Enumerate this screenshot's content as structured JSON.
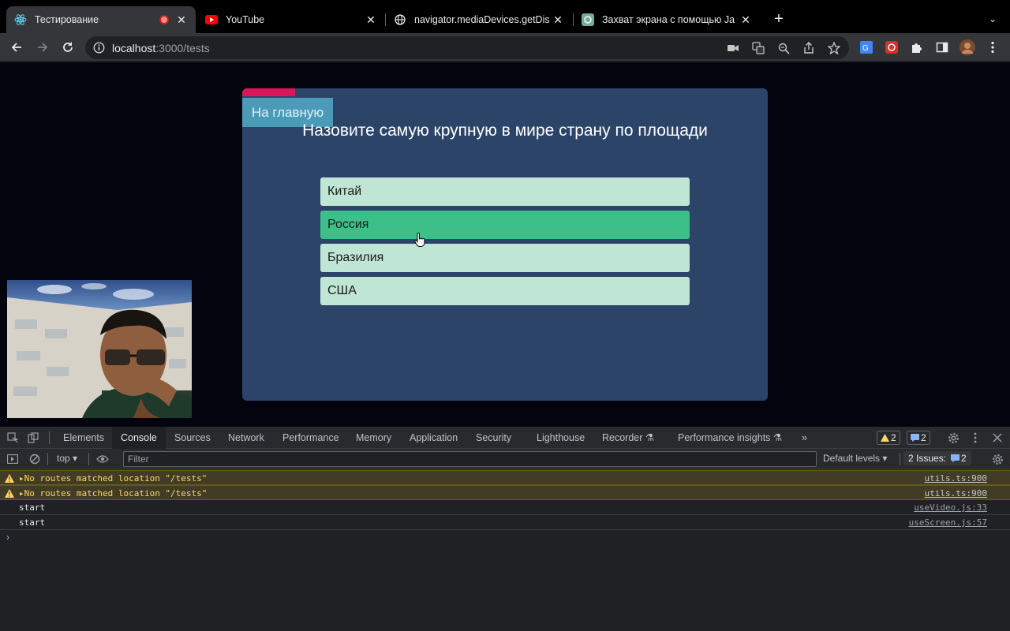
{
  "browser": {
    "tabs": [
      {
        "title": "Тестирование",
        "active": true,
        "recording": true
      },
      {
        "title": "YouTube"
      },
      {
        "title": "navigator.mediaDevices.getDis"
      },
      {
        "title": "Захват экрана с помощью Ja"
      }
    ],
    "new_tab": "+",
    "url_host": "localhost",
    "url_path": ":3000/tests"
  },
  "page": {
    "home_button": "На главную",
    "question": "Назовите самую крупную в мире страну по площади",
    "answers": [
      "Китай",
      "Россия",
      "Бразилия",
      "США"
    ],
    "hovered_answer": "Россия",
    "progress_fraction": 0.1
  },
  "devtools": {
    "tabs": [
      "Elements",
      "Console",
      "Sources",
      "Network",
      "Performance",
      "Memory",
      "Application",
      "Security",
      "Lighthouse",
      "Recorder",
      "Performance insights"
    ],
    "active_tab": "Console",
    "warnings_count": "2",
    "messages_count": "2",
    "context": "top",
    "filter_placeholder": "Filter",
    "levels": "Default levels",
    "issues_label": "2 Issues:",
    "issues_count": "2",
    "console": [
      {
        "type": "warn",
        "text": "No routes matched location \"/tests\"",
        "source": "utils.ts:900"
      },
      {
        "type": "warn",
        "text": "No routes matched location \"/tests\"",
        "source": "utils.ts:900"
      },
      {
        "type": "log",
        "text": "start",
        "source": "useVideo.js:33"
      },
      {
        "type": "log",
        "text": "start",
        "source": "useScreen.js:57"
      }
    ],
    "prompt": "›"
  },
  "colors": {
    "card": "#2c4468",
    "answer": "#bfe5d4",
    "answer_hover": "#3dbf8a",
    "progress": "#d8175a",
    "home_button": "#4a9ab8"
  }
}
